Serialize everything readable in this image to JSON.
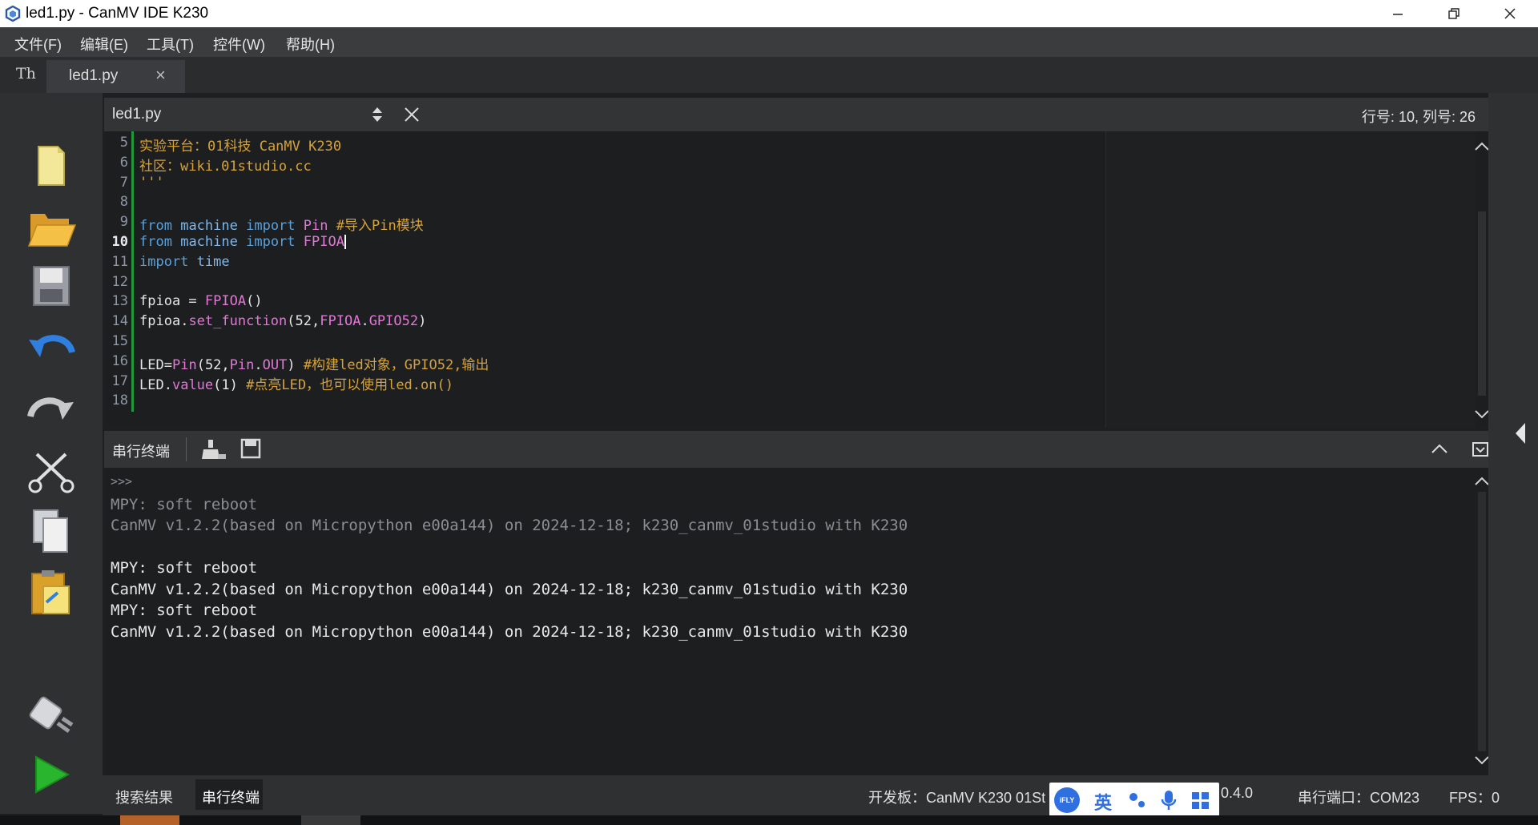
{
  "window": {
    "title": "led1.py - CanMV IDE K230",
    "minimize_icon": "minimize-icon",
    "maximize_icon": "restore-icon",
    "close_icon": "close-icon"
  },
  "menubar": [
    "文件(F)",
    "编辑(E)",
    "工具(T)",
    "控件(W)",
    "帮助(H)"
  ],
  "tabs": {
    "icon": "Th",
    "active": "led1.py"
  },
  "editor": {
    "filename": "led1.py",
    "cursor_position": "行号: 10, 列号: 26",
    "current_line": 10,
    "lines": [
      {
        "n": "5",
        "t": "实验平台：01科技 CanMV K230"
      },
      {
        "n": "6",
        "t": "社区：wiki.01studio.cc"
      },
      {
        "n": "7",
        "t": "'''"
      },
      {
        "n": "8",
        "t": ""
      },
      {
        "n": "9",
        "t": "from machine import Pin #导入Pin模块"
      },
      {
        "n": "10",
        "t": "from machine import FPIOA"
      },
      {
        "n": "11",
        "t": "import time"
      },
      {
        "n": "12",
        "t": ""
      },
      {
        "n": "13",
        "t": "fpioa = FPIOA()"
      },
      {
        "n": "14",
        "t": "fpioa.set_function(52,FPIOA.GPIO52)"
      },
      {
        "n": "15",
        "t": ""
      },
      {
        "n": "16",
        "t": "LED=Pin(52,Pin.OUT) #构建led对象，GPIO52,输出"
      },
      {
        "n": "17",
        "t": "LED.value(1) #点亮LED，也可以使用led.on()"
      },
      {
        "n": "18",
        "t": ""
      }
    ]
  },
  "serial": {
    "title": "串行终端",
    "lines": [
      ">>>",
      "MPY: soft reboot",
      "CanMV v1.2.2(based on Micropython e00a144) on 2024-12-18; k230_canmv_01studio with K230",
      "",
      "MPY: soft reboot",
      "CanMV v1.2.2(based on Micropython e00a144) on 2024-12-18; k230_canmv_01studio with K230",
      "MPY: soft reboot",
      "CanMV v1.2.2(based on Micropython e00a144) on 2024-12-18; k230_canmv_01studio with K230"
    ]
  },
  "statusbar": {
    "tab_search": "搜索结果",
    "tab_serial": "串行终端",
    "board": "开发板：CanMV K230 01St",
    "version": "0.4.0",
    "port": "串行端口：COM23",
    "fps": "FPS：0"
  },
  "ime": {
    "logo": "iFLY",
    "lang": "英"
  }
}
